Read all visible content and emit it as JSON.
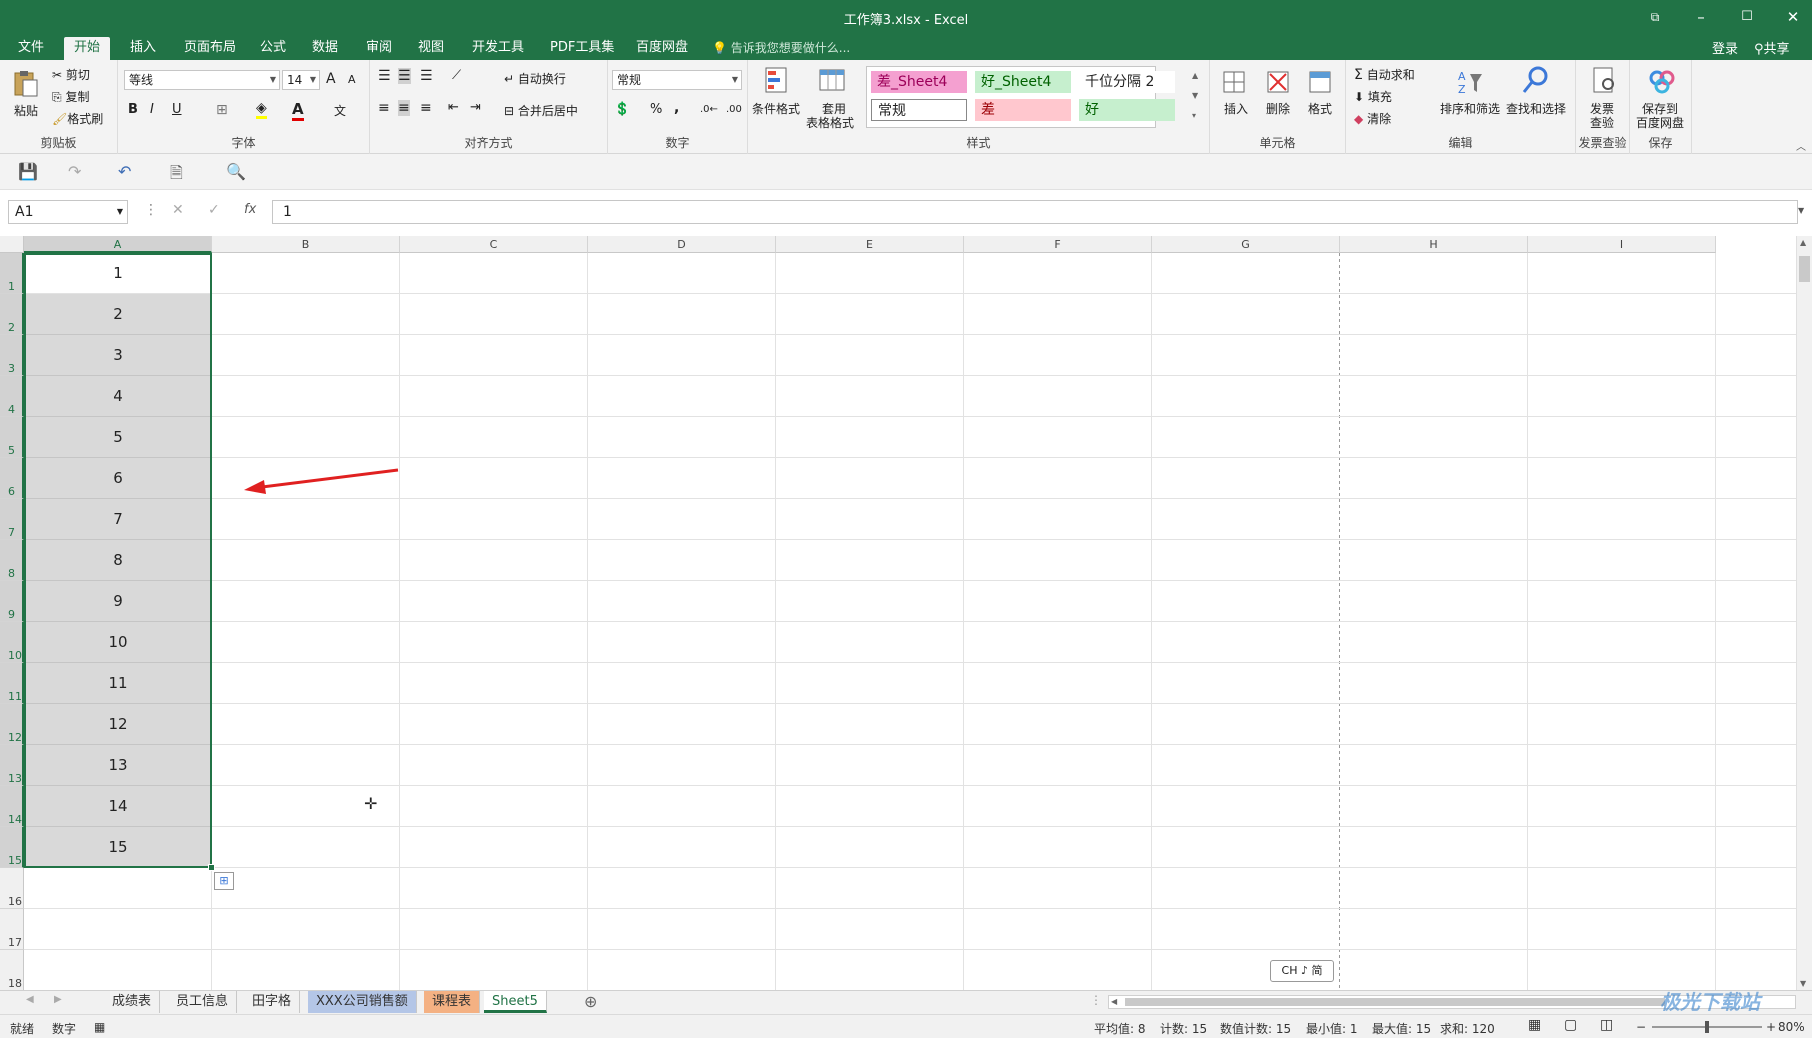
{
  "window": {
    "title": "工作簿3.xlsx - Excel",
    "restore_icon": "ribbon-display-icon",
    "minimize": "–",
    "maximize": "☐",
    "close": "✕"
  },
  "menu": {
    "tabs": [
      "文件",
      "开始",
      "插入",
      "页面布局",
      "公式",
      "数据",
      "审阅",
      "视图",
      "开发工具",
      "PDF工具集",
      "百度网盘"
    ],
    "active_tab": "开始",
    "tell_me": "告诉我您想要做什么...",
    "login": "登录",
    "share": "共享"
  },
  "ribbon": {
    "clipboard": {
      "paste": "粘贴",
      "cut": "剪切",
      "copy": "复制",
      "format_painter": "格式刷",
      "label": "剪贴板"
    },
    "font": {
      "name": "等线",
      "size": "14",
      "bold": "B",
      "italic": "I",
      "underline": "U",
      "grow": "A",
      "shrink": "A",
      "label": "字体"
    },
    "alignment": {
      "wrap": "自动换行",
      "merge": "合并后居中",
      "label": "对齐方式"
    },
    "number": {
      "format": "常规",
      "percent": "%",
      "comma": ",",
      "label": "数字"
    },
    "styles": {
      "conditional": "条件格式",
      "table_format_1": "套用",
      "table_format_2": "表格格式",
      "cells": [
        {
          "text": "差_Sheet4",
          "bg": "#f4a0d0",
          "fg": "#9c0059"
        },
        {
          "text": "好_Sheet4",
          "bg": "#c6efce",
          "fg": "#006100"
        },
        {
          "text": "千位分隔 2",
          "bg": "#ffffff",
          "fg": "#222222"
        },
        {
          "text": "常规",
          "bg": "#ffffff",
          "fg": "#222222"
        },
        {
          "text": "差",
          "bg": "#ffc7ce",
          "fg": "#9c0006"
        },
        {
          "text": "好",
          "bg": "#c6efce",
          "fg": "#006100"
        }
      ],
      "label": "样式"
    },
    "cells_group": {
      "insert": "插入",
      "delete": "删除",
      "format": "格式",
      "label": "单元格"
    },
    "editing": {
      "autosum": "自动求和",
      "fill": "填充",
      "clear": "清除",
      "sort_filter": "排序和筛选",
      "find_select": "查找和选择",
      "label": "编辑"
    },
    "invoice": {
      "check_1": "发票",
      "check_2": "查验",
      "label": "发票查验"
    },
    "save": {
      "save_1": "保存到",
      "save_2": "百度网盘",
      "label": "保存"
    }
  },
  "formula_bar": {
    "name_box": "A1",
    "cancel": "✕",
    "confirm": "✓",
    "fx": "fx",
    "value": "1"
  },
  "grid": {
    "columns": [
      "A",
      "B",
      "C",
      "D",
      "E",
      "F",
      "G",
      "H",
      "I"
    ],
    "selected_column": "A",
    "rows": [
      "1",
      "2",
      "3",
      "4",
      "5",
      "6",
      "7",
      "8",
      "9",
      "10",
      "11",
      "12",
      "13",
      "14",
      "15",
      "16",
      "17",
      "18"
    ],
    "column_a_values": [
      "1",
      "2",
      "3",
      "4",
      "5",
      "6",
      "7",
      "8",
      "9",
      "10",
      "11",
      "12",
      "13",
      "14",
      "15"
    ],
    "arrow_color": "#e02020",
    "ime_indicator": "CH ♪ 简"
  },
  "sheets": {
    "tabs": [
      {
        "name": "成绩表",
        "bg": "#f1f1f1"
      },
      {
        "name": "员工信息",
        "bg": "#f1f1f1"
      },
      {
        "name": "田字格",
        "bg": "#f1f1f1"
      },
      {
        "name": "XXX公司销售额",
        "bg": "#b4c6e7"
      },
      {
        "name": "课程表",
        "bg": "#f4b183"
      },
      {
        "name": "Sheet5",
        "bg": "#ffffff"
      }
    ],
    "active": "Sheet5",
    "add": "⊕"
  },
  "status": {
    "mode": "就绪",
    "num": "数字",
    "average": "平均值: 8",
    "count": "计数: 15",
    "numeric_count": "数值计数: 15",
    "min": "最小值: 1",
    "max": "最大值: 15",
    "sum": "求和: 120",
    "zoom": "80%"
  },
  "watermark": "极光下载站",
  "accent": "#217346"
}
